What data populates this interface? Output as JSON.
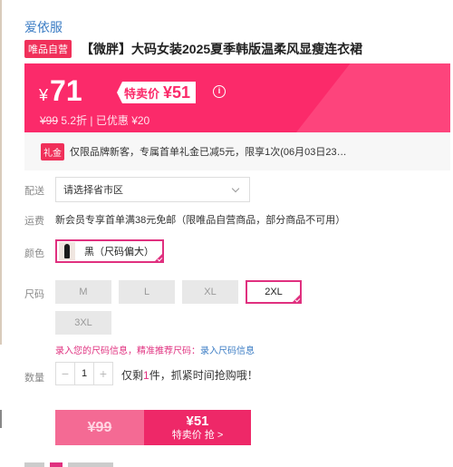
{
  "brand": "爱依服",
  "product": {
    "badge": "唯品自营",
    "title": "【微胖】大码女装2025夏季韩版温柔风显瘦连衣裙"
  },
  "price": {
    "currency": "¥",
    "main": "71",
    "special_label": "特卖价",
    "special_value": "¥51",
    "info_icon": "info-circle-icon",
    "original": "¥99",
    "discount": "5.2折",
    "saved": "| 已优惠 ¥20"
  },
  "coupon": {
    "badge": "礼金",
    "text": "仅限品牌新客，专属首单礼金已减5元，限享1次(06月03日23…"
  },
  "delivery": {
    "label": "配送",
    "select_value": "请选择省市区"
  },
  "shipping": {
    "label": "运费",
    "text": "新会员专享首单满38元免邮（限唯品自营商品，部分商品不可用）"
  },
  "color": {
    "label": "颜色",
    "selected": "黑（尺码偏大）"
  },
  "size": {
    "label": "尺码",
    "options": [
      "M",
      "L",
      "XL",
      "2XL",
      "3XL"
    ],
    "selected": "2XL"
  },
  "measure": {
    "text": "录入您的尺码信息，精准推荐尺码：",
    "link": "录入尺码信息"
  },
  "quantity": {
    "label": "数量",
    "minus": "−",
    "value": "1",
    "plus": "+",
    "stock_prefix": "仅剩",
    "stock_count": "1",
    "stock_suffix": "件，抓紧时间抢购哦！"
  },
  "buy": {
    "original": "¥99",
    "special_price": "¥51",
    "special_label": "特卖价 抢 >"
  },
  "colors": {
    "accent": "#fb2a6a",
    "selected_border": "#e0307f",
    "link": "#3b7cc4"
  }
}
